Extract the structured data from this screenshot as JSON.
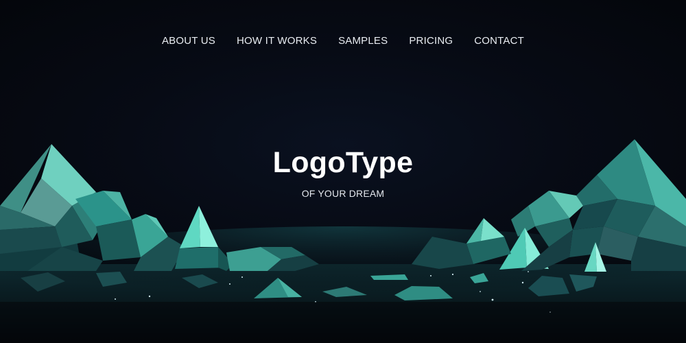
{
  "nav": {
    "items": [
      {
        "label": "ABOUT US"
      },
      {
        "label": "HOW IT WORKS"
      },
      {
        "label": "SAMPLES"
      },
      {
        "label": "PRICING"
      },
      {
        "label": "CONTACT"
      }
    ]
  },
  "brand": {
    "title": "LogoType",
    "tagline": "OF YOUR DREAM"
  },
  "colors": {
    "background": "#05070d",
    "crystal_light": "#7fe3cf",
    "crystal_mid": "#2f9b8d",
    "crystal_dark": "#14424a",
    "text": "#ffffff"
  }
}
